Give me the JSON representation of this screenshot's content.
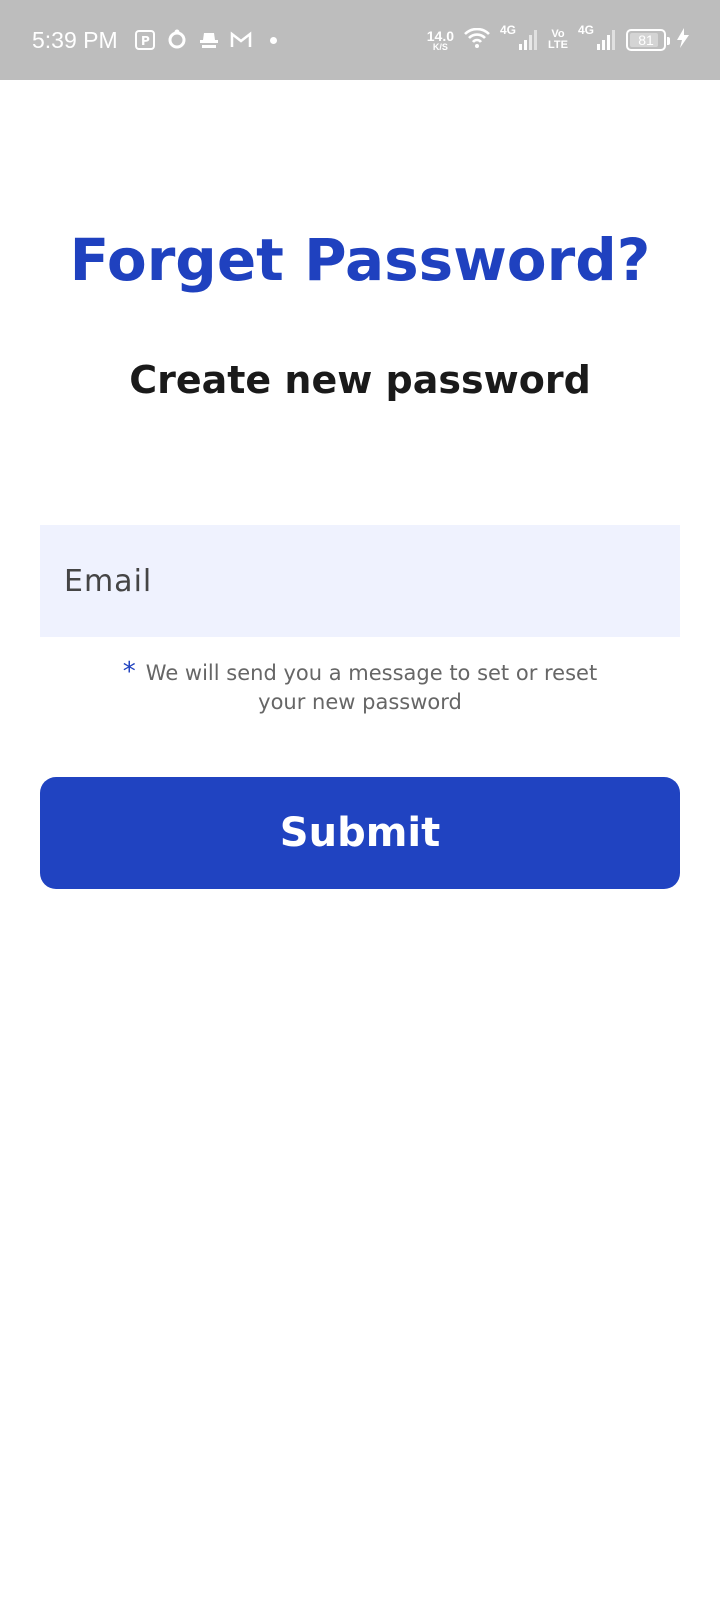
{
  "status_bar": {
    "time": "5:39 PM",
    "speed_value": "14.0",
    "speed_unit": "K/S",
    "net1": "4G",
    "volte_top": "Vo",
    "volte_bottom": "LTE",
    "net2": "4G",
    "battery": "81",
    "notification_icons": [
      "parking-icon",
      "sync-icon",
      "spy-icon",
      "gmail-icon"
    ]
  },
  "page": {
    "title": "Forget Password?",
    "subtitle": "Create new password",
    "email_placeholder": "Email",
    "note_star": "*",
    "note_text": "We will send you a message to set or reset your new password",
    "submit_label": "Submit"
  },
  "colors": {
    "accent": "#1f41bf",
    "field_bg": "#eff2fe",
    "status_bar_bg": "#bdbdbd"
  }
}
